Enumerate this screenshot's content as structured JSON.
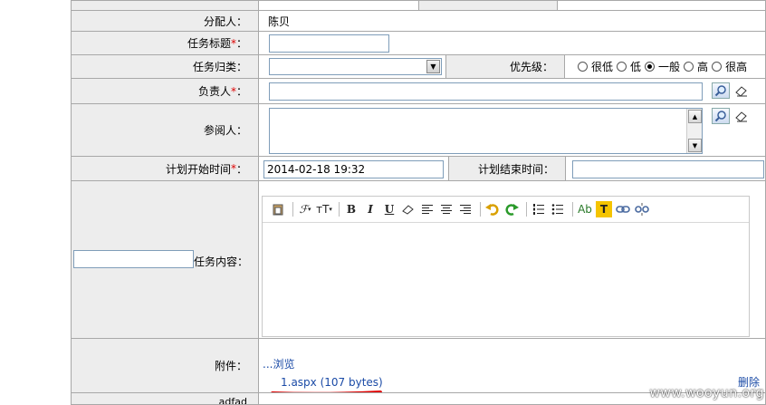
{
  "form": {
    "assigner": {
      "label": "分配人：",
      "value": "陈贝"
    },
    "title": {
      "label": "任务标题",
      "required_mark": "*",
      "colon": "："
    },
    "category": {
      "label": "任务归类：",
      "selected": ""
    },
    "priority": {
      "label": "优先级：",
      "options": [
        {
          "label": "很低",
          "selected": false
        },
        {
          "label": "低",
          "selected": false
        },
        {
          "label": "一般",
          "selected": true
        },
        {
          "label": "高",
          "selected": false
        },
        {
          "label": "很高",
          "selected": false
        }
      ]
    },
    "owner": {
      "label": "负责人",
      "required_mark": "*",
      "colon": "："
    },
    "readers": {
      "label": "参阅人："
    },
    "start_time": {
      "label": "计划开始时间",
      "required_mark": "*",
      "colon": "：",
      "value": "2014-02-18 19:32"
    },
    "end_time": {
      "label": "计划结束时间：",
      "value": ""
    },
    "content": {
      "label": "任务内容："
    },
    "attachment": {
      "label": "附件：",
      "browse": "...浏览",
      "file": "1.aspx (107 bytes)",
      "delete": "删除"
    },
    "next_row_label": "adfad"
  },
  "editor_toolbar": {
    "font_glyph": "ℱ",
    "size_glyph": "тT",
    "bold": "B",
    "italic": "I",
    "underline": "U",
    "color_text": "Ab",
    "bg_text": "T"
  },
  "watermark": "www.wooyun.org",
  "colors": {
    "accent_link": "#1a4aa6",
    "underline_mark": "#e00000",
    "toolbar_highlight": "#f5c400"
  }
}
